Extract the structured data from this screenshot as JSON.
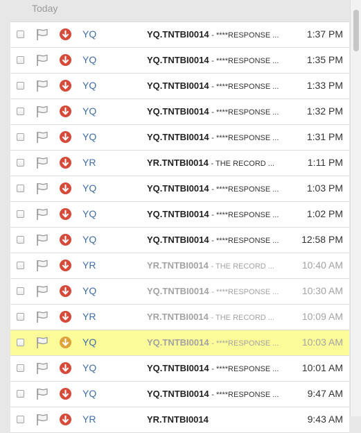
{
  "group_header": "Today",
  "colors": {
    "sender": "#3e6ea8",
    "priority": "#d64a3a",
    "highlight": "#fbfb9a"
  },
  "rows": [
    {
      "sender": "YQ",
      "subject": "YQ.TNTBI0014",
      "preview": "- ****RESPONSE ...",
      "time": "1:37 PM",
      "state": "unread"
    },
    {
      "sender": "YQ",
      "subject": "YQ.TNTBI0014",
      "preview": "- ****RESPONSE ...",
      "time": "1:35 PM",
      "state": "unread"
    },
    {
      "sender": "YQ",
      "subject": "YQ.TNTBI0014",
      "preview": "- ****RESPONSE ...",
      "time": "1:33 PM",
      "state": "unread"
    },
    {
      "sender": "YQ",
      "subject": "YQ.TNTBI0014",
      "preview": "- ****RESPONSE ...",
      "time": "1:32 PM",
      "state": "unread"
    },
    {
      "sender": "YQ",
      "subject": "YQ.TNTBI0014",
      "preview": "- ****RESPONSE ...",
      "time": "1:31 PM",
      "state": "unread"
    },
    {
      "sender": "YR",
      "subject": "YR.TNTBI0014",
      "preview": "- THE RECORD ...",
      "time": "1:11 PM",
      "state": "unread"
    },
    {
      "sender": "YQ",
      "subject": "YQ.TNTBI0014",
      "preview": "- ****RESPONSE ...",
      "time": "1:03 PM",
      "state": "unread"
    },
    {
      "sender": "YQ",
      "subject": "YQ.TNTBI0014",
      "preview": "- ****RESPONSE ...",
      "time": "1:02 PM",
      "state": "unread"
    },
    {
      "sender": "YQ",
      "subject": "YQ.TNTBI0014",
      "preview": "- ****RESPONSE ...",
      "time": "12:58 PM",
      "state": "unread"
    },
    {
      "sender": "YR",
      "subject": "YR.TNTBI0014",
      "preview": "- THE RECORD ...",
      "time": "10:40 AM",
      "state": "read"
    },
    {
      "sender": "YQ",
      "subject": "YQ.TNTBI0014",
      "preview": "- ****RESPONSE ...",
      "time": "10:30 AM",
      "state": "read"
    },
    {
      "sender": "YR",
      "subject": "YR.TNTBI0014",
      "preview": "- THE RECORD ...",
      "time": "10:09 AM",
      "state": "read"
    },
    {
      "sender": "YQ",
      "subject": "YQ.TNTBI0014",
      "preview": "- ****RESPONSE ...",
      "time": "10:03 AM",
      "state": "read-highlighted"
    },
    {
      "sender": "YQ",
      "subject": "YQ.TNTBI0014",
      "preview": "- ****RESPONSE ...",
      "time": "10:01 AM",
      "state": "unread"
    },
    {
      "sender": "YQ",
      "subject": "YQ.TNTBI0014",
      "preview": "- ****RESPONSE ...",
      "time": "9:47 AM",
      "state": "unread"
    },
    {
      "sender": "YR",
      "subject": "YR.TNTBI0014",
      "preview": "",
      "time": "9:43 AM",
      "state": "unread"
    }
  ]
}
